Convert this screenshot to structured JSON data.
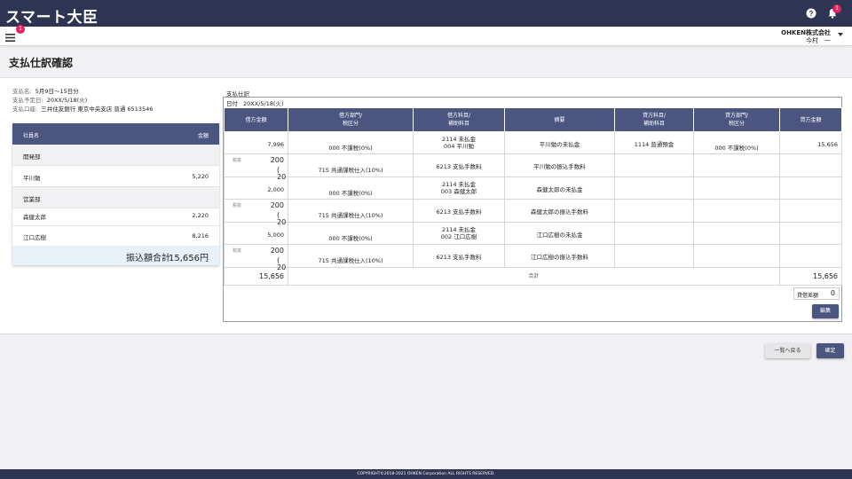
{
  "app": {
    "title": "スマート大臣",
    "notification_count": "1",
    "menu_badge": "1"
  },
  "header": {
    "company": "OHKEN株式会社",
    "user": "今村　一"
  },
  "page": {
    "title": "支払仕訳確認"
  },
  "payment_info": [
    {
      "label": "支払名:",
      "value": "5月9日〜15日分"
    },
    {
      "label": "支払予定日:",
      "value": "20XX/5/18(火)"
    },
    {
      "label": "支払口座:",
      "value": "三井住友銀行 東京中央支店 普通 6513546"
    }
  ],
  "employee_table": {
    "headers": {
      "name": "社員名",
      "amount": "金額"
    },
    "rows": [
      {
        "name": "開発部",
        "amount": "",
        "type": "dept"
      },
      {
        "name": "平川勉",
        "amount": "5,220",
        "type": "emp"
      },
      {
        "name": "営業部",
        "amount": "",
        "type": "dept"
      },
      {
        "name": "森健太郎",
        "amount": "2,220",
        "type": "emp"
      },
      {
        "name": "江口広樹",
        "amount": "8,216",
        "type": "emp"
      }
    ],
    "total_label": "振込額合計",
    "total_value": "15,656円"
  },
  "journal": {
    "section_label": "支払仕訳",
    "date_label": "日付",
    "date_value": "20XX/5/18(火)",
    "headers": {
      "debit_amount": "借方金額",
      "debit_dept": "借方部門/",
      "debit_tax": "税区分",
      "debit_account": "借方科目/",
      "debit_sub": "補助科目",
      "summary": "摘要",
      "credit_account": "貸方科目/",
      "credit_sub": "補助科目",
      "credit_dept": "貸方部門/",
      "credit_tax": "税区分",
      "credit_amount": "貸方金額"
    },
    "rows": [
      {
        "kind": "main",
        "debit_amount": "7,996",
        "debit_tax": "000 不課税(0%)",
        "account": "2114 未払金",
        "sub": "004 平川勉",
        "summary": "平川勉の未払金",
        "credit_account": "1114 普通預金",
        "credit_tax": "000 不課税(0%)",
        "credit_amount": "15,656"
      },
      {
        "kind": "sub",
        "tax_tag": "税抜",
        "debit_amount": "200",
        "paren": "( 20",
        "debit_tax": "715 共通課税仕入(10%)",
        "account": "6213 支払手数料",
        "sub": "",
        "summary": "平川勉の振込手数料"
      },
      {
        "kind": "main",
        "debit_amount": "2,000",
        "debit_tax": "000 不課税(0%)",
        "account": "2114 未払金",
        "sub": "003 森健太郎",
        "summary": "森健太郎の未払金"
      },
      {
        "kind": "sub",
        "tax_tag": "税抜",
        "debit_amount": "200",
        "paren": "( 20",
        "debit_tax": "715 共通課税仕入(10%)",
        "account": "6213 支払手数料",
        "sub": "",
        "summary": "森健太郎の振込手数料"
      },
      {
        "kind": "main",
        "debit_amount": "5,000",
        "debit_tax": "000 不課税(0%)",
        "account": "2114 未払金",
        "sub": "002 江口広樹",
        "summary": "江口広樹の未払金"
      },
      {
        "kind": "sub",
        "tax_tag": "税抜",
        "debit_amount": "200",
        "paren": "( 20",
        "debit_tax": "715 共通課税仕入(10%)",
        "account": "6213 支払手数料",
        "sub": "",
        "summary": "江口広樹の振込手数料"
      }
    ],
    "total": {
      "debit": "15,656",
      "label": "合計",
      "credit": "15,656"
    },
    "diff": {
      "label": "貸借差額",
      "value": "0"
    },
    "edit_label": "編集"
  },
  "actions": {
    "back": "一覧へ戻る",
    "confirm": "確定"
  },
  "footer": {
    "copyright": "COPYRIGHT©2018-2021 OHKEN Corporation ALL RIGHTS RESERVED."
  },
  "colors": {
    "header": "#2d3552",
    "accent": "#4b5680",
    "badge": "#e0245e"
  }
}
